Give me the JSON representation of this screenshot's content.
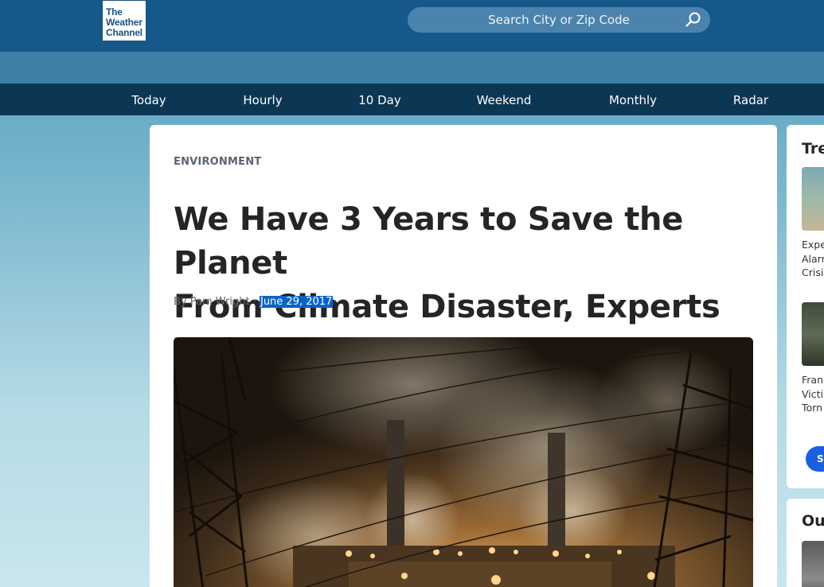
{
  "header": {
    "logo_lines": [
      "The",
      "Weather",
      "Channel"
    ],
    "search_placeholder": "Search City or Zip Code"
  },
  "nav": {
    "items": [
      {
        "label": "Today"
      },
      {
        "label": "Hourly"
      },
      {
        "label": "10 Day"
      },
      {
        "label": "Weekend"
      },
      {
        "label": "Monthly"
      },
      {
        "label": "Radar"
      }
    ]
  },
  "article": {
    "category": "ENVIRONMENT",
    "headline_line1": "We Have 3 Years to Save the Planet",
    "headline_line2": "From Climate Disaster, Experts Warn",
    "byline_prefix": "By Pam Wright · ",
    "date": "June 29, 2017"
  },
  "sidebar": {
    "trending_title": "Tre",
    "items": [
      {
        "lines": [
          "Expe",
          "Alarr",
          "Crisis"
        ]
      },
      {
        "lines": [
          "Fran",
          "Victi",
          "Torn"
        ]
      }
    ],
    "button_label": "S",
    "second_title": "Ou"
  },
  "colors": {
    "header_bg": "#14598a",
    "nav_bg": "#0b3654",
    "selection": "#0a64c8",
    "accent_button": "#1a5fe0"
  }
}
